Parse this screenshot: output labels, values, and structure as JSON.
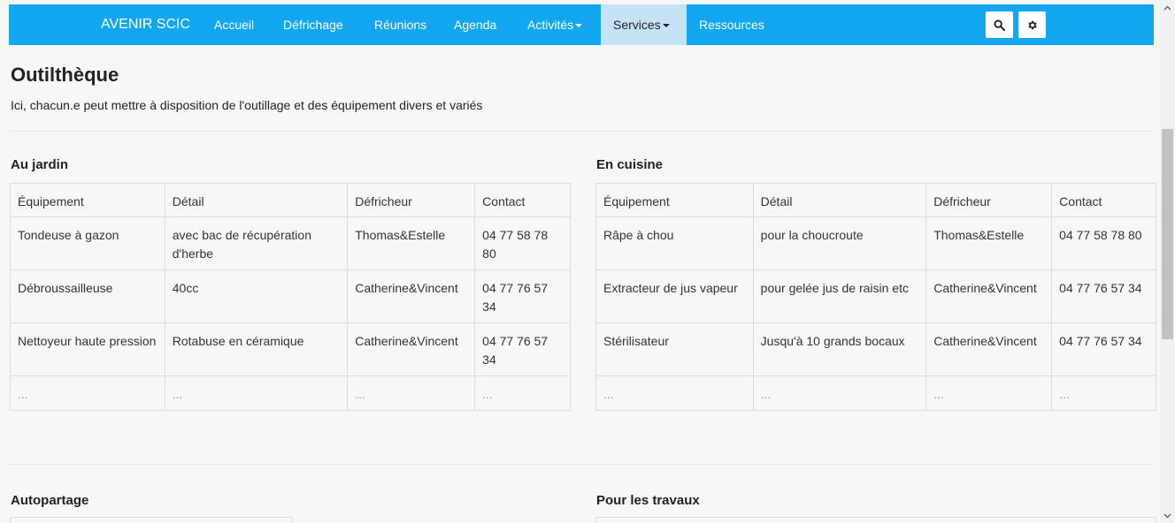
{
  "nav": {
    "brand": "AVENIR SCIC",
    "items": [
      "Accueil",
      "Défrichage",
      "Réunions",
      "Agenda",
      "Activités",
      "Services",
      "Ressources"
    ]
  },
  "page": {
    "title": "Outilthèque",
    "intro": "Ici, chacun.e peut mettre à disposition de l'outillage et des équipement divers et variés"
  },
  "columns": [
    "Équipement",
    "Détail",
    "Défricheur",
    "Contact"
  ],
  "jardin": {
    "title": "Au jardin",
    "rows": [
      [
        "Tondeuse à gazon",
        "avec bac de récupération d'herbe",
        "Thomas&Estelle",
        "04 77 58 78 80"
      ],
      [
        "Débroussailleuse",
        "40cc",
        "Catherine&Vincent",
        "04 77 76 57 34"
      ],
      [
        "Nettoyeur haute pression",
        "Rotabuse en céramique",
        "Catherine&Vincent",
        "04 77 76 57 34"
      ],
      [
        "...",
        "...",
        "...",
        "..."
      ]
    ]
  },
  "cuisine": {
    "title": "En cuisine",
    "rows": [
      [
        "Râpe à chou",
        "pour la choucroute",
        "Thomas&Estelle",
        "04 77 58 78 80"
      ],
      [
        "Extracteur de jus vapeur",
        "pour gelée jus de raisin etc",
        "Catherine&Vincent",
        "04 77 76 57 34"
      ],
      [
        "Stérilisateur",
        "Jusqu'à 10 grands bocaux",
        "Catherine&Vincent",
        "04 77 76 57 34"
      ],
      [
        "...",
        "...",
        "...",
        "..."
      ]
    ]
  },
  "autopartage": {
    "title": "Autopartage"
  },
  "travaux": {
    "title": "Pour les travaux"
  },
  "colors": {
    "navbar": "#12a7f0",
    "active_tab": "#c6e3f6"
  },
  "icons": [
    "search-icon",
    "gear-icon"
  ]
}
